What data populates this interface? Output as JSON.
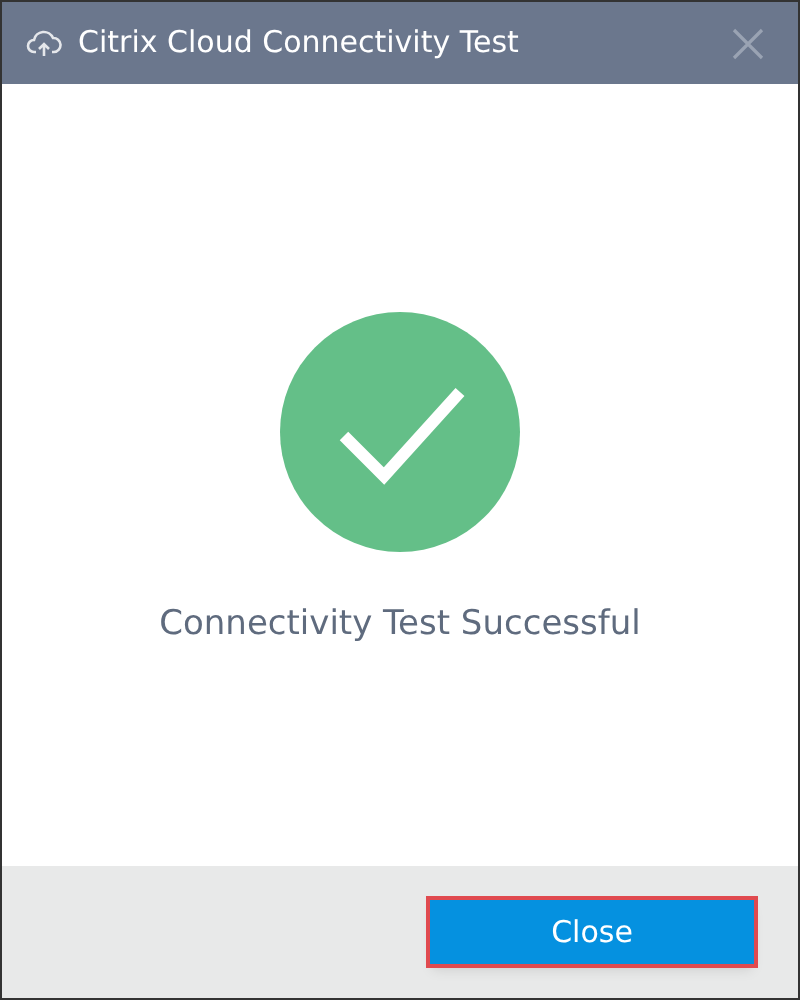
{
  "window": {
    "title": "Citrix Cloud Connectivity Test"
  },
  "result": {
    "success": true,
    "message": "Connectivity Test Successful"
  },
  "buttons": [
    {
      "label": "Close",
      "highlighted": true
    }
  ]
}
